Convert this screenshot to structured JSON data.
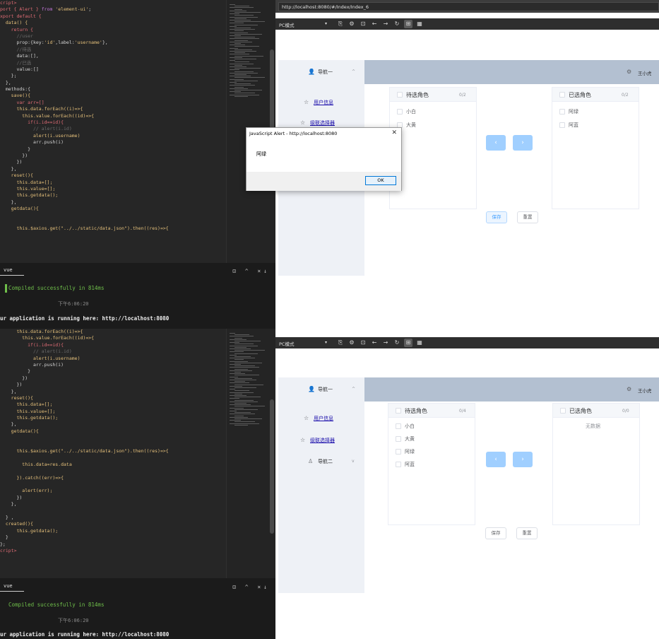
{
  "editor_top": {
    "lines": [
      [
        {
          "t": "cript>",
          "c": "#e06c75"
        }
      ],
      [
        {
          "t": "port { Alert } ",
          "c": "#e06c75"
        },
        {
          "t": "from ",
          "c": "#c678dd"
        },
        {
          "t": "'element-ui'",
          "c": "#e5c07b"
        },
        {
          "t": ";",
          "c": "#d4d4d4"
        }
      ],
      [
        {
          "t": "xport default {",
          "c": "#e06c75"
        }
      ],
      [
        {
          "t": "  data() {",
          "c": "#e5c07b"
        }
      ],
      [
        {
          "t": "    return {",
          "c": "#e06c75"
        }
      ],
      [
        {
          "t": "      //user",
          "c": "#6a6a6a"
        }
      ],
      [
        {
          "t": "      prop:{key:",
          "c": "#d4d4d4"
        },
        {
          "t": "'id'",
          "c": "#e5c07b"
        },
        {
          "t": ",label:",
          "c": "#d4d4d4"
        },
        {
          "t": "'username'",
          "c": "#e5c07b"
        },
        {
          "t": "},",
          "c": "#d4d4d4"
        }
      ],
      [
        {
          "t": "      //待选",
          "c": "#6a6a6a"
        }
      ],
      [
        {
          "t": "      data:[],",
          "c": "#d4d4d4"
        }
      ],
      [
        {
          "t": "      //已选",
          "c": "#6a6a6a"
        }
      ],
      [
        {
          "t": "      value:[]",
          "c": "#d4d4d4"
        }
      ],
      [
        {
          "t": "    };",
          "c": "#d4d4d4"
        }
      ],
      [
        {
          "t": "  },",
          "c": "#d4d4d4"
        }
      ],
      [
        {
          "t": "  methods:{",
          "c": "#d4d4d4"
        }
      ],
      [
        {
          "t": "    save(){",
          "c": "#e5c07b"
        }
      ],
      [
        {
          "t": "      var arr=[]",
          "c": "#e06c75"
        }
      ],
      [
        {
          "t": "      this.data.forEach((i)=>{",
          "c": "#e5c07b"
        }
      ],
      [
        {
          "t": "        this.value.forEach((id)=>{",
          "c": "#e5c07b"
        }
      ],
      [
        {
          "t": "          if(i.id==id){",
          "c": "#e06c75"
        }
      ],
      [
        {
          "t": "            // alert(i.id)",
          "c": "#6a6a6a"
        }
      ],
      [
        {
          "t": "            alert(i.username)",
          "c": "#e5c07b"
        }
      ],
      [
        {
          "t": "            arr.push(i)",
          "c": "#d4d4d4"
        }
      ],
      [
        {
          "t": "          }",
          "c": "#d4d4d4"
        }
      ],
      [
        {
          "t": "        })",
          "c": "#d4d4d4"
        }
      ],
      [
        {
          "t": "      })",
          "c": "#d4d4d4"
        }
      ],
      [
        {
          "t": "    },",
          "c": "#d4d4d4"
        }
      ],
      [
        {
          "t": "    reset(){",
          "c": "#e5c07b"
        }
      ],
      [
        {
          "t": "      this.data=[];",
          "c": "#e5c07b"
        }
      ],
      [
        {
          "t": "      this.value=[];",
          "c": "#e5c07b"
        }
      ],
      [
        {
          "t": "      this.getdata();",
          "c": "#e5c07b"
        }
      ],
      [
        {
          "t": "    },",
          "c": "#d4d4d4"
        }
      ],
      [
        {
          "t": "    getdata(){",
          "c": "#e5c07b"
        }
      ],
      [
        {
          "t": "",
          "c": "#d4d4d4"
        }
      ],
      [
        {
          "t": "",
          "c": "#d4d4d4"
        }
      ],
      [
        {
          "t": "      this.$axios.get(\"../../static/data.json\").then((res)=>{",
          "c": "#e5c07b"
        }
      ]
    ]
  },
  "editor_bottom": {
    "lines": [
      [
        {
          "t": "      this.data.forEach((i)=>{",
          "c": "#e5c07b"
        }
      ],
      [
        {
          "t": "        this.value.forEach((id)=>{",
          "c": "#e5c07b"
        }
      ],
      [
        {
          "t": "          if(i.id==id){",
          "c": "#e06c75"
        }
      ],
      [
        {
          "t": "            // alert(i.id)",
          "c": "#6a6a6a"
        }
      ],
      [
        {
          "t": "            alert(i.username)",
          "c": "#e5c07b"
        }
      ],
      [
        {
          "t": "            arr.push(i)",
          "c": "#d4d4d4"
        }
      ],
      [
        {
          "t": "          }",
          "c": "#d4d4d4"
        }
      ],
      [
        {
          "t": "        })",
          "c": "#d4d4d4"
        }
      ],
      [
        {
          "t": "      })",
          "c": "#d4d4d4"
        }
      ],
      [
        {
          "t": "    },",
          "c": "#d4d4d4"
        }
      ],
      [
        {
          "t": "    reset(){",
          "c": "#e5c07b"
        }
      ],
      [
        {
          "t": "      this.data=[];",
          "c": "#e5c07b"
        }
      ],
      [
        {
          "t": "      this.value=[];",
          "c": "#e5c07b"
        }
      ],
      [
        {
          "t": "      this.getdata();",
          "c": "#e5c07b"
        }
      ],
      [
        {
          "t": "    },",
          "c": "#d4d4d4"
        }
      ],
      [
        {
          "t": "    getdata(){",
          "c": "#e5c07b"
        }
      ],
      [
        {
          "t": "",
          "c": "#d4d4d4"
        }
      ],
      [
        {
          "t": "",
          "c": "#d4d4d4"
        }
      ],
      [
        {
          "t": "      this.$axios.get(\"../../static/data.json\").then((res)=>{",
          "c": "#e5c07b"
        }
      ],
      [
        {
          "t": "",
          "c": "#d4d4d4"
        }
      ],
      [
        {
          "t": "        this.data=res.data",
          "c": "#e5c07b"
        }
      ],
      [
        {
          "t": "",
          "c": "#d4d4d4"
        }
      ],
      [
        {
          "t": "      }).catch((err)=>{",
          "c": "#e5c07b"
        }
      ],
      [
        {
          "t": "",
          "c": "#d4d4d4"
        }
      ],
      [
        {
          "t": "        alert(err);",
          "c": "#e5c07b"
        }
      ],
      [
        {
          "t": "      })",
          "c": "#d4d4d4"
        }
      ],
      [
        {
          "t": "    },",
          "c": "#d4d4d4"
        }
      ],
      [
        {
          "t": "",
          "c": "#d4d4d4"
        }
      ],
      [
        {
          "t": "  } ,",
          "c": "#d4d4d4"
        }
      ],
      [
        {
          "t": "  created(){",
          "c": "#e5c07b"
        }
      ],
      [
        {
          "t": "      this.getdata();",
          "c": "#e5c07b"
        }
      ],
      [
        {
          "t": "  }",
          "c": "#d4d4d4"
        }
      ],
      [
        {
          "t": "};",
          "c": "#d4d4d4"
        }
      ],
      [
        {
          "t": "cript>",
          "c": "#e06c75"
        }
      ]
    ]
  },
  "terminal_top": {
    "tab": "vue",
    "icons": "⊡ ^ ×↓",
    "compiled": "Compiled successfully in 814ms",
    "time": "下午6:06:20",
    "running": "ur application is running here: http://localhost:8080"
  },
  "terminal_bottom": {
    "tab": "vue",
    "icons": "⊡ ^ ×↓",
    "compiled": "Compiled successfully in 814ms",
    "time": "下午6:06:20",
    "running": "ur application is running here: http://localhost:8080"
  },
  "browser": {
    "url": "http://localhost:8080/#/Index/Index_6",
    "mode": "PC模式",
    "nav_group1": "导航一",
    "nav_user_info": "用户信息",
    "nav_cascader": "级联选择器",
    "nav_group2": "导航二",
    "username": "王小虎",
    "left_title": "待选角色",
    "right_title": "已选角色",
    "save": "保存",
    "reset": "重置",
    "empty": "无数据"
  },
  "top_panel": {
    "left_count": "0/2",
    "right_count": "0/2",
    "left_items": [
      "小白",
      "大黄"
    ],
    "right_items": [
      "阿绿",
      "阿蓝"
    ]
  },
  "bottom_panel": {
    "left_count": "0/4",
    "right_count": "0/0",
    "left_items": [
      "小白",
      "大黄",
      "阿绿",
      "阿蓝"
    ]
  },
  "alert": {
    "title": "JavaScript Alert - http://localhost:8080",
    "close": "✕",
    "message": "阿绿",
    "ok": "OK"
  },
  "colors": {
    "editor_bg": "#262626",
    "terminal_bg": "#1b1b1b",
    "success_green": "#6fbf4a",
    "header_bg": "#b3c0d1",
    "nav_bg": "#eef1f6",
    "arrow_btn": "#a0cfff"
  },
  "icons": {
    "user": "user-icon",
    "star": "star-icon",
    "gear": "gear-icon",
    "chevron": "chevron-icon"
  }
}
